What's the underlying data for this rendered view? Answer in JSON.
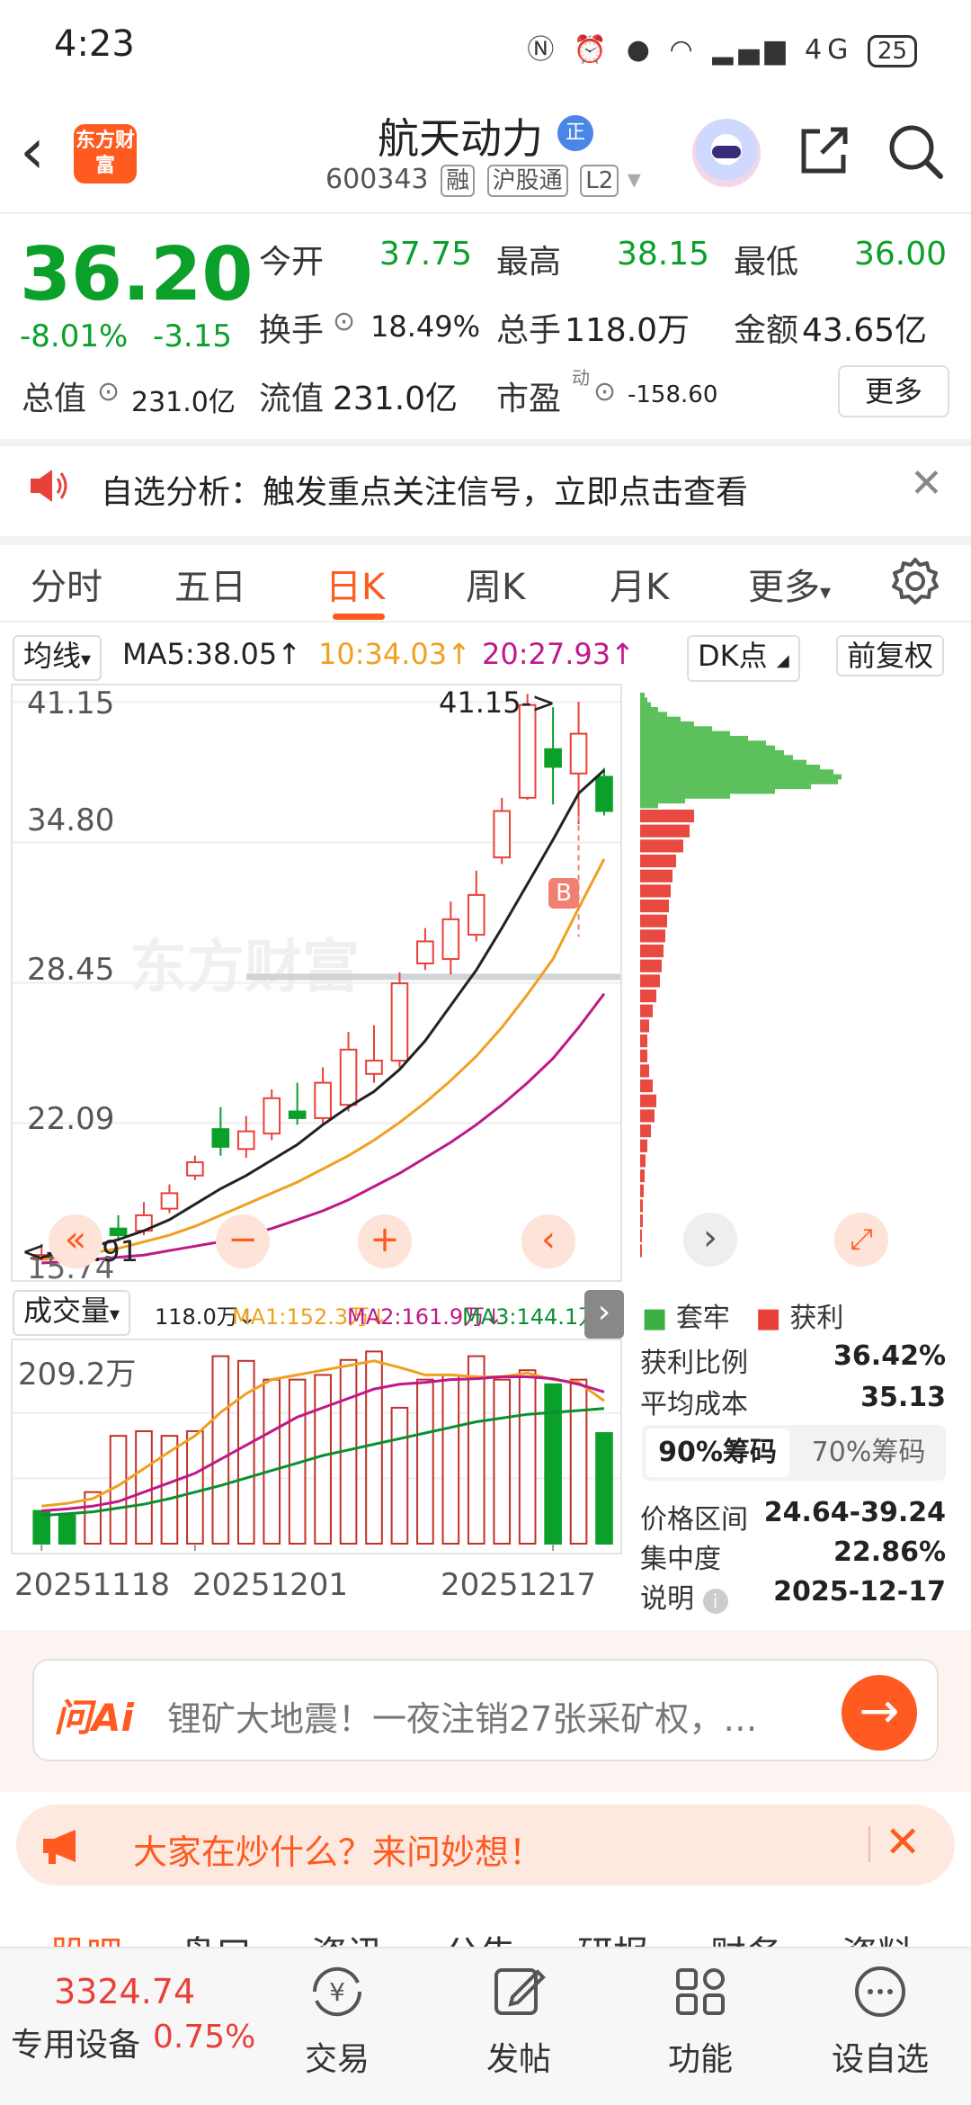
{
  "status": {
    "time": "4:23",
    "battery": "25",
    "network": "4G"
  },
  "header": {
    "logo_text": "东方财富",
    "stock_name": "航天动力",
    "name_badge": "正",
    "stock_code": "600343",
    "tags": [
      "融",
      "沪股通",
      "L2"
    ]
  },
  "quote": {
    "price": "36.20",
    "pct_change": "-8.01%",
    "abs_change": "-3.15",
    "stats": [
      {
        "label": "今开",
        "value": "37.75",
        "color": "green"
      },
      {
        "label": "最高",
        "value": "38.15",
        "color": "green"
      },
      {
        "label": "最低",
        "value": "36.00",
        "color": "green"
      },
      {
        "label": "换手",
        "value": "18.49%",
        "color": "dark"
      },
      {
        "label": "总手",
        "value": "118.0万",
        "color": "dark"
      },
      {
        "label": "金额",
        "value": "43.65亿",
        "color": "dark"
      },
      {
        "label": "总值",
        "value": "231.0亿",
        "color": "dark"
      },
      {
        "label": "流值",
        "value": "231.0亿",
        "color": "dark"
      },
      {
        "label": "市盈",
        "value": "-158.60",
        "color": "dark"
      }
    ],
    "pe_superscript": "动",
    "more_label": "更多"
  },
  "notice": {
    "text": "自选分析：触发重点关注信号，立即点击查看"
  },
  "tabs": [
    {
      "label": "分时",
      "active": false
    },
    {
      "label": "五日",
      "active": false
    },
    {
      "label": "日K",
      "active": true
    },
    {
      "label": "周K",
      "active": false
    },
    {
      "label": "月K",
      "active": false
    },
    {
      "label": "更多",
      "active": false
    }
  ],
  "ma": {
    "selector": "均线",
    "ma5": "MA5:38.05↑",
    "ma10": "10:34.03↑",
    "ma20": "20:27.93↑",
    "dk_label": "DK点",
    "adjust_label": "前复权"
  },
  "kline": {
    "y_labels": [
      "41.15",
      "34.80",
      "28.45",
      "22.09",
      "15.74"
    ],
    "high_annotation": "41.15->",
    "low_annotation": "<-15.91",
    "buy_marker": "B",
    "watermark": "东方财富"
  },
  "volume": {
    "selector": "成交量",
    "total": "118.0万↓",
    "ma1": "MA1:152.3万↓",
    "ma2": "MA2:161.9万↓",
    "ma3": "MA3:144.1万↑",
    "max_label": "209.2万",
    "dates": [
      "20251118",
      "20251201",
      "20251217"
    ]
  },
  "chips": {
    "legend_stuck": "套牢",
    "legend_profit": "获利",
    "profit_ratio_label": "获利比例",
    "profit_ratio": "36.42%",
    "avg_cost_label": "平均成本",
    "avg_cost": "35.13",
    "tab_90": "90%筹码",
    "tab_70": "70%筹码",
    "range_label": "价格区间",
    "range": "24.64-39.24",
    "concentration_label": "集中度",
    "concentration": "22.86%",
    "note_label": "说明",
    "note_date": "2025-12-17"
  },
  "ai": {
    "logo": "问Ai",
    "text": "锂矿大地震！一夜注销27张采矿权，…"
  },
  "hot": {
    "text": "大家在炒什么？来问妙想！"
  },
  "partial_tabs": [
    "股吧",
    "盘口",
    "资讯",
    "公告",
    "研报",
    "财务",
    "资料"
  ],
  "bottom": {
    "index_value": "3324.74",
    "index_name": "专用设备",
    "index_pct": "0.75%",
    "nav": [
      {
        "label": "交易",
        "icon": "trade-icon"
      },
      {
        "label": "发帖",
        "icon": "post-icon"
      },
      {
        "label": "功能",
        "icon": "function-icon"
      },
      {
        "label": "设自选",
        "icon": "favorite-icon"
      }
    ]
  },
  "colors": {
    "accent": "#ff5a1f",
    "up": "#e8413a",
    "down": "#0aa02a"
  },
  "chart_data": {
    "type": "candlestick",
    "y_range": [
      15.74,
      41.15
    ],
    "candles": [
      {
        "o": 15.9,
        "c": 16.1,
        "h": 16.6,
        "l": 15.9,
        "up": true
      },
      {
        "o": 16.1,
        "c": 16.5,
        "h": 16.8,
        "l": 16.0,
        "up": true
      },
      {
        "o": 16.6,
        "c": 16.9,
        "h": 17.4,
        "l": 16.4,
        "up": true
      },
      {
        "o": 17.3,
        "c": 17.0,
        "h": 17.9,
        "l": 16.8,
        "up": false
      },
      {
        "o": 17.2,
        "c": 17.9,
        "h": 18.5,
        "l": 17.0,
        "up": true
      },
      {
        "o": 18.2,
        "c": 18.9,
        "h": 19.3,
        "l": 18.0,
        "up": true
      },
      {
        "o": 19.7,
        "c": 20.3,
        "h": 20.6,
        "l": 19.5,
        "up": true
      },
      {
        "o": 21.8,
        "c": 21.0,
        "h": 22.8,
        "l": 20.6,
        "up": false
      },
      {
        "o": 20.9,
        "c": 21.7,
        "h": 22.4,
        "l": 20.5,
        "up": true
      },
      {
        "o": 21.6,
        "c": 23.2,
        "h": 23.6,
        "l": 21.3,
        "up": true
      },
      {
        "o": 22.6,
        "c": 22.3,
        "h": 23.9,
        "l": 22.0,
        "up": false
      },
      {
        "o": 22.3,
        "c": 23.9,
        "h": 24.6,
        "l": 22.0,
        "up": true
      },
      {
        "o": 22.9,
        "c": 25.4,
        "h": 26.2,
        "l": 22.6,
        "up": true
      },
      {
        "o": 24.3,
        "c": 24.9,
        "h": 26.5,
        "l": 23.9,
        "up": true
      },
      {
        "o": 24.9,
        "c": 28.4,
        "h": 28.9,
        "l": 24.6,
        "up": true
      },
      {
        "o": 29.3,
        "c": 30.3,
        "h": 30.9,
        "l": 29.0,
        "up": true
      },
      {
        "o": 29.5,
        "c": 31.3,
        "h": 32.1,
        "l": 28.8,
        "up": true
      },
      {
        "o": 30.6,
        "c": 32.4,
        "h": 33.5,
        "l": 30.3,
        "up": true
      },
      {
        "o": 34.1,
        "c": 36.2,
        "h": 36.8,
        "l": 33.8,
        "up": true
      },
      {
        "o": 36.8,
        "c": 41.0,
        "h": 41.5,
        "l": 36.7,
        "up": true
      },
      {
        "o": 39.0,
        "c": 38.2,
        "h": 40.9,
        "l": 36.5,
        "up": false
      },
      {
        "o": 37.9,
        "c": 39.7,
        "h": 41.15,
        "l": 35.6,
        "up": true
      },
      {
        "o": 37.75,
        "c": 36.2,
        "h": 38.15,
        "l": 36.0,
        "up": false
      }
    ],
    "ma5": [
      16.0,
      16.2,
      16.5,
      16.8,
      17.2,
      17.7,
      18.4,
      19.1,
      19.7,
      20.4,
      21.1,
      22.0,
      22.8,
      23.5,
      24.5,
      25.8,
      27.4,
      29.0,
      30.9,
      32.9,
      34.9,
      37.0,
      38.05
    ],
    "ma10": [
      15.9,
      16.0,
      16.2,
      16.4,
      16.7,
      17.0,
      17.4,
      17.9,
      18.4,
      18.9,
      19.4,
      20.0,
      20.6,
      21.3,
      22.1,
      23.0,
      24.0,
      25.1,
      26.4,
      27.9,
      29.5,
      31.8,
      34.03
    ],
    "ma20": [
      15.74,
      15.8,
      15.9,
      16.0,
      16.1,
      16.3,
      16.5,
      16.7,
      17.0,
      17.3,
      17.7,
      18.1,
      18.6,
      19.2,
      19.8,
      20.5,
      21.2,
      22.0,
      22.9,
      23.9,
      25.0,
      26.4,
      27.93
    ],
    "volume": {
      "max": 209.2,
      "values": [
        35,
        30,
        55,
        115,
        120,
        115,
        120,
        200,
        195,
        175,
        175,
        180,
        196,
        205,
        145,
        175,
        180,
        200,
        175,
        185,
        170,
        175,
        118
      ],
      "down": [
        true,
        true,
        false,
        false,
        false,
        false,
        false,
        false,
        false,
        false,
        false,
        false,
        false,
        false,
        false,
        false,
        false,
        false,
        false,
        false,
        true,
        false,
        true
      ],
      "ma_a": [
        40,
        43,
        48,
        62,
        80,
        98,
        115,
        140,
        160,
        175,
        180,
        185,
        190,
        195,
        188,
        180,
        180,
        178,
        178,
        182,
        175,
        172,
        152.3
      ],
      "ma_b": [
        35,
        37,
        40,
        45,
        55,
        65,
        75,
        90,
        105,
        120,
        135,
        145,
        155,
        165,
        170,
        172,
        175,
        176,
        178,
        178,
        176,
        170,
        161.9
      ],
      "ma_c": [
        30,
        32,
        34,
        38,
        42,
        48,
        55,
        62,
        70,
        78,
        86,
        94,
        100,
        106,
        112,
        118,
        124,
        130,
        134,
        138,
        140,
        142,
        144.1
      ]
    },
    "chips": {
      "stuck": [
        5,
        8,
        12,
        20,
        30,
        45,
        60,
        80,
        100,
        120,
        140,
        150,
        160,
        170,
        185,
        200,
        215,
        224,
        220,
        190,
        150,
        100,
        50,
        20
      ],
      "profit": [
        60,
        55,
        48,
        40,
        36,
        34,
        32,
        30,
        28,
        26,
        24,
        22,
        18,
        14,
        10,
        8,
        8,
        10,
        14,
        18,
        16,
        12,
        8,
        6,
        5,
        4,
        3,
        3,
        2,
        2
      ]
    }
  }
}
